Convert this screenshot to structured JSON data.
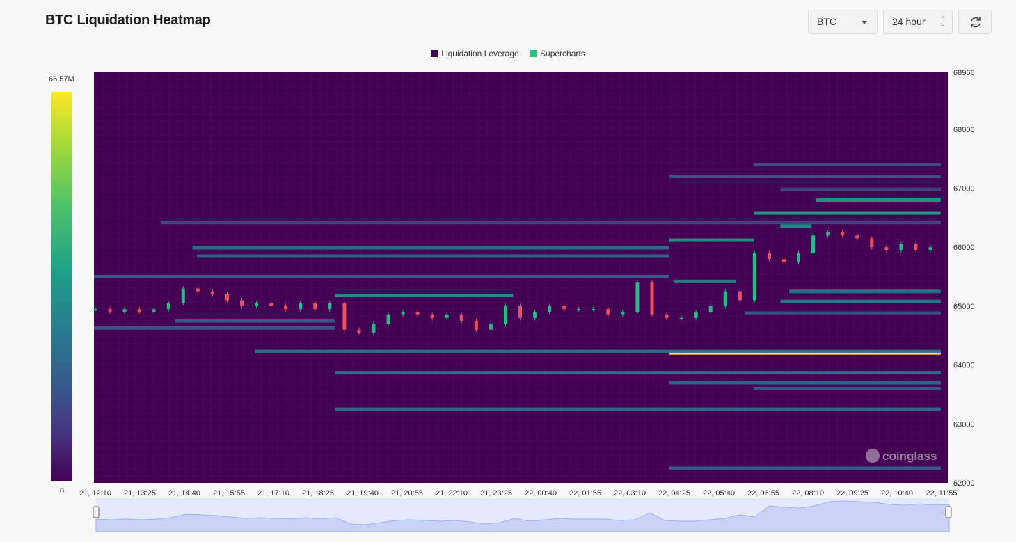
{
  "header": {
    "title": "BTC Liquidation Heatmap"
  },
  "controls": {
    "coin": "BTC",
    "range": "24 hour",
    "refresh_icon": "refresh-icon"
  },
  "legend": [
    {
      "label": "Liquidation Leverage",
      "color": "#3b0f4f"
    },
    {
      "label": "Supercharts",
      "color": "#1dc97c"
    }
  ],
  "colorbar": {
    "max_label": "66.57M",
    "min_label": "0"
  },
  "watermark": "coinglass",
  "colors": {
    "background": "#440154",
    "up": "#1dbf84",
    "down": "#e8505b",
    "max": "#fde725"
  },
  "chart_data": {
    "type": "heatmap",
    "title": "BTC Liquidation Heatmap",
    "xlabel": "",
    "ylabel": "",
    "ylim": [
      62000,
      68966
    ],
    "y_ticks": [
      68966,
      68000,
      67000,
      66000,
      65000,
      64000,
      63000,
      62000
    ],
    "x_ticks": [
      "21, 12:10",
      "21, 13:25",
      "21, 14:40",
      "21, 15:55",
      "21, 17:10",
      "21, 18:25",
      "21, 19:40",
      "21, 20:55",
      "21, 22:10",
      "21, 23:25",
      "22, 00:40",
      "22, 01:55",
      "22, 03:10",
      "22, 04:25",
      "22, 05:40",
      "22, 06:55",
      "22, 08:10",
      "22, 09:25",
      "22, 10:40",
      "22, 11:55"
    ],
    "colorbar_range": [
      0,
      66570000
    ],
    "price_series": {
      "name": "BTC price",
      "x_start_index": 0,
      "x_end_index": 19,
      "values": [
        64950,
        64900,
        64950,
        64900,
        64950,
        65050,
        65300,
        65250,
        65200,
        65100,
        65000,
        65050,
        65000,
        64950,
        65050,
        64950,
        65050,
        64600,
        64550,
        64700,
        64850,
        64900,
        64850,
        64800,
        64850,
        64750,
        64600,
        64700,
        65000,
        64800,
        64900,
        65000,
        64950,
        64950,
        64950,
        64850,
        64900,
        65400,
        64850,
        64800,
        64800,
        64900,
        65000,
        65250,
        65100,
        65900,
        65800,
        65750,
        65900,
        66200,
        66250,
        66200,
        66150,
        66000,
        65950,
        66050,
        65950,
        66000
      ]
    },
    "liquidation_levels": [
      {
        "price": 64200,
        "from": 13.1,
        "to": 19.2,
        "intensity": 1.0
      },
      {
        "price": 66580,
        "from": 15.0,
        "to": 19.2,
        "intensity": 0.62
      },
      {
        "price": 66800,
        "from": 16.4,
        "to": 19.2,
        "intensity": 0.6
      },
      {
        "price": 66120,
        "from": 13.1,
        "to": 15.0,
        "intensity": 0.58
      },
      {
        "price": 66360,
        "from": 15.6,
        "to": 16.3,
        "intensity": 0.55
      },
      {
        "price": 65420,
        "from": 13.2,
        "to": 14.6,
        "intensity": 0.5
      },
      {
        "price": 65180,
        "from": 5.6,
        "to": 9.6,
        "intensity": 0.55
      },
      {
        "price": 64230,
        "from": 3.8,
        "to": 19.2,
        "intensity": 0.42
      },
      {
        "price": 63870,
        "from": 5.6,
        "to": 19.2,
        "intensity": 0.4
      },
      {
        "price": 63250,
        "from": 5.6,
        "to": 19.2,
        "intensity": 0.38
      },
      {
        "price": 65990,
        "from": 2.4,
        "to": 13.1,
        "intensity": 0.4
      },
      {
        "price": 65850,
        "from": 2.5,
        "to": 13.1,
        "intensity": 0.36
      },
      {
        "price": 65500,
        "from": 0.1,
        "to": 13.1,
        "intensity": 0.34
      },
      {
        "price": 64750,
        "from": 2.0,
        "to": 5.6,
        "intensity": 0.34
      },
      {
        "price": 64630,
        "from": 0.1,
        "to": 5.6,
        "intensity": 0.3
      },
      {
        "price": 66420,
        "from": 1.7,
        "to": 19.2,
        "intensity": 0.26
      },
      {
        "price": 65080,
        "from": 15.6,
        "to": 19.2,
        "intensity": 0.45
      },
      {
        "price": 65250,
        "from": 15.8,
        "to": 19.2,
        "intensity": 0.45
      },
      {
        "price": 63700,
        "from": 13.1,
        "to": 19.2,
        "intensity": 0.36
      },
      {
        "price": 63600,
        "from": 15.0,
        "to": 19.2,
        "intensity": 0.3
      },
      {
        "price": 67200,
        "from": 13.1,
        "to": 19.2,
        "intensity": 0.3
      },
      {
        "price": 67400,
        "from": 15.0,
        "to": 19.2,
        "intensity": 0.28
      },
      {
        "price": 62250,
        "from": 13.1,
        "to": 19.2,
        "intensity": 0.34
      },
      {
        "price": 64880,
        "from": 14.8,
        "to": 19.2,
        "intensity": 0.3
      },
      {
        "price": 66980,
        "from": 15.6,
        "to": 19.2,
        "intensity": 0.24
      }
    ]
  }
}
